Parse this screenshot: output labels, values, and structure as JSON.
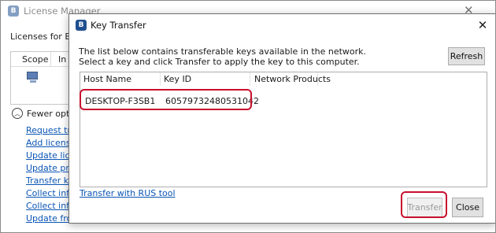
{
  "background_window": {
    "title": "License Manager",
    "close_glyph": "✕",
    "app_icon_letter": "B",
    "heading": "Licenses for Buildi",
    "table_columns": [
      "Scope",
      "In U"
    ],
    "fewer_options": "Fewer option",
    "links": [
      "Request trial",
      "Add license",
      "Update licens",
      "Update produ",
      "Transfer key",
      "Collect inform",
      "Collect inform",
      "Update from"
    ]
  },
  "dialog": {
    "title": "Key Transfer",
    "app_icon_letter": "B",
    "close_glyph": "✕",
    "description_line1": "The list below contains transferable keys available in the network.",
    "description_line2": "Select a key and click Transfer to apply the key to this computer.",
    "refresh_label": "Refresh",
    "columns": [
      "Host Name",
      "Key ID",
      "Network Products"
    ],
    "rows": [
      {
        "host": "DESKTOP-F3SB1",
        "key_id": "60579732480531042",
        "products": ""
      }
    ],
    "rus_link": "Transfer with RUS tool",
    "transfer_label": "Transfer",
    "close_label": "Close"
  },
  "colors": {
    "highlight": "#c8102e",
    "link": "#0b55b5",
    "app_icon": "#1f4f8f"
  },
  "icons": {
    "app": "app-logo-icon",
    "computer": "computer-icon",
    "fewer": "chevron-up-circle-icon",
    "close": "close-icon"
  }
}
